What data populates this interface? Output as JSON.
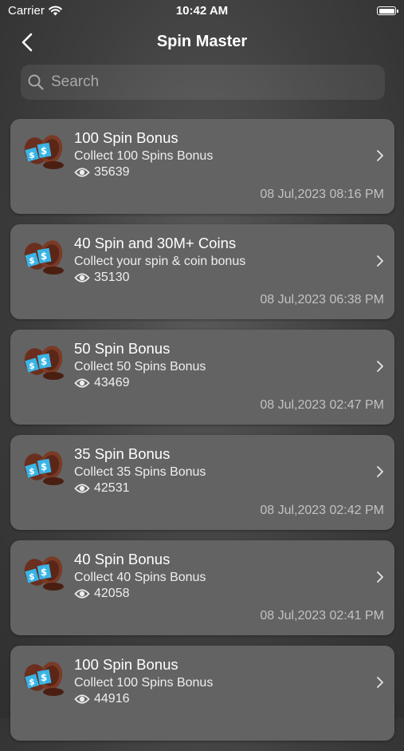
{
  "status": {
    "carrier": "Carrier",
    "time": "10:42 AM"
  },
  "nav": {
    "title": "Spin Master"
  },
  "search": {
    "placeholder": "Search"
  },
  "items": [
    {
      "title": "100 Spin Bonus",
      "subtitle": "Collect 100 Spins Bonus",
      "views": "35639",
      "date": "08 Jul,2023 08:16 PM"
    },
    {
      "title": "40 Spin and 30M+ Coins",
      "subtitle": "Collect your spin & coin bonus",
      "views": "35130",
      "date": "08 Jul,2023 06:38 PM"
    },
    {
      "title": "50 Spin Bonus",
      "subtitle": "Collect 50 Spins Bonus",
      "views": "43469",
      "date": "08 Jul,2023 02:47 PM"
    },
    {
      "title": "35 Spin Bonus",
      "subtitle": "Collect 35 Spins Bonus",
      "views": "42531",
      "date": "08 Jul,2023 02:42 PM"
    },
    {
      "title": "40 Spin Bonus",
      "subtitle": "Collect 40 Spins Bonus",
      "views": "42058",
      "date": "08 Jul,2023 02:41 PM"
    },
    {
      "title": "100 Spin Bonus",
      "subtitle": "Collect 100 Spins Bonus",
      "views": "44916",
      "date": ""
    }
  ],
  "icons": {
    "back": "chevron-left-icon",
    "search": "magnifier-icon",
    "views": "eye-icon",
    "row": "chevron-right-icon",
    "thumb": "spin-coin-icon"
  },
  "colors": {
    "card": "#636363",
    "coin_brown": "#6b2f1f",
    "coin_blue": "#39b4e6"
  }
}
